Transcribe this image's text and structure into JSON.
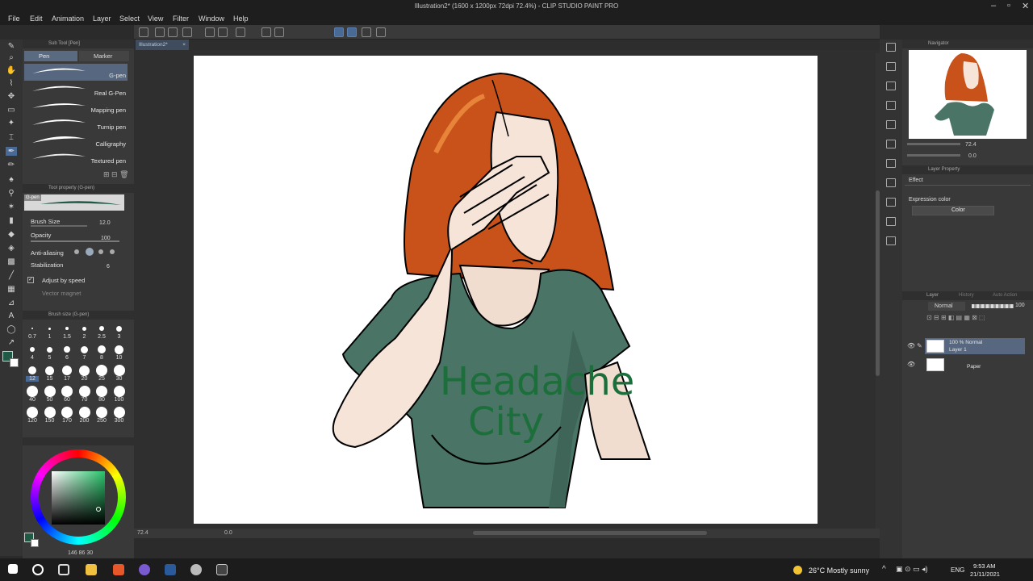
{
  "app": {
    "title": "Illustration2* (1600 x 1200px 72dpi 72.4%) - CLIP STUDIO PAINT PRO"
  },
  "menu": [
    "File",
    "Edit",
    "Animation",
    "Layer",
    "Select",
    "View",
    "Filter",
    "Window",
    "Help"
  ],
  "document_tab": "Illustration2*",
  "subtool": {
    "header": "Sub Tool [Pen]",
    "tabs": [
      "Pen",
      "Marker"
    ],
    "items": [
      "G-pen",
      "Real G-Pen",
      "Mapping pen",
      "Turnip pen",
      "Calligraphy",
      "Textured pen"
    ]
  },
  "toolprop": {
    "header": "Tool property (G-pen)",
    "preset": "G-pen",
    "brush_size_label": "Brush Size",
    "brush_size_value": "12.0",
    "opacity_label": "Opacity",
    "opacity_value": "100",
    "antialias_label": "Anti-aliasing",
    "stabilization_label": "Stabilization",
    "stabilization_value": "6",
    "adjust_label": "Adjust by speed",
    "vector_label": "Vector magnet"
  },
  "brushsize": {
    "header": "Brush size (G-pen)",
    "sizes": [
      "0.7",
      "1",
      "1.5",
      "2",
      "2.5",
      "3",
      "4",
      "5",
      "6",
      "7",
      "8",
      "10",
      "12",
      "15",
      "17",
      "20",
      "25",
      "30",
      "40",
      "50",
      "60",
      "70",
      "80",
      "100",
      "120",
      "150",
      "170",
      "200",
      "250",
      "300"
    ]
  },
  "color": {
    "readout": "146  86  30",
    "main": "#1f5a44",
    "accent": "#4a7fc0"
  },
  "navigator": {
    "header": "Navigator",
    "zoom": "72.4",
    "angle": "0.0"
  },
  "layerprop": {
    "header": "Layer Property",
    "effect": "Effect",
    "expression_label": "Expression color",
    "expression_value": "Color"
  },
  "layers": {
    "header": "Layer",
    "tabs": [
      "History",
      "Auto Action"
    ],
    "blend": "Normal",
    "opacity": "100",
    "items": [
      {
        "line1": "100 % Normal",
        "line2": "Layer 1"
      },
      {
        "line1": "",
        "line2": "Paper"
      }
    ]
  },
  "status": {
    "zoom": "72.4",
    "angle": "0.0"
  },
  "canvas": {
    "shirt_text_1": "Headache",
    "shirt_text_2": "City"
  },
  "taskbar": {
    "weather": "26°C  Mostly sunny",
    "lang": "ENG",
    "time": "9:53 AM",
    "date": "21/11/2021"
  }
}
